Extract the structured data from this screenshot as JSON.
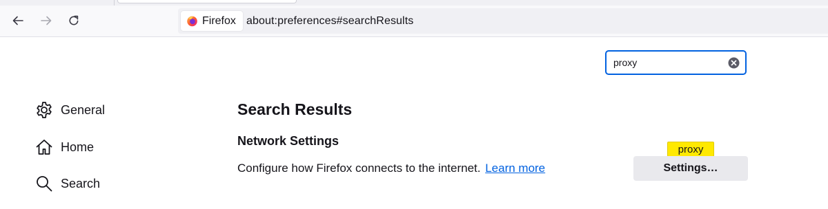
{
  "browser": {
    "identity_label": "Firefox",
    "url": "about:preferences#searchResults"
  },
  "icons": {
    "back": "arrow-left-icon",
    "forward": "arrow-right-icon",
    "reload": "reload-icon",
    "firefox": "firefox-logo-icon",
    "clear": "clear-search-icon",
    "general": "gear-icon",
    "home": "home-icon",
    "search": "magnifier-icon"
  },
  "search": {
    "value": "proxy"
  },
  "sidebar": {
    "items": [
      {
        "label": "General"
      },
      {
        "label": "Home"
      },
      {
        "label": "Search"
      }
    ]
  },
  "main": {
    "title": "Search Results",
    "section_title": "Network Settings",
    "description": "Configure how Firefox connects to the internet.",
    "learn_more": "Learn more",
    "settings_button": "Settings…",
    "highlight_tooltip": "proxy"
  },
  "colors": {
    "accent": "#0061e0",
    "tooltip": "#ffe900",
    "button_bg": "#e9e9ed"
  }
}
